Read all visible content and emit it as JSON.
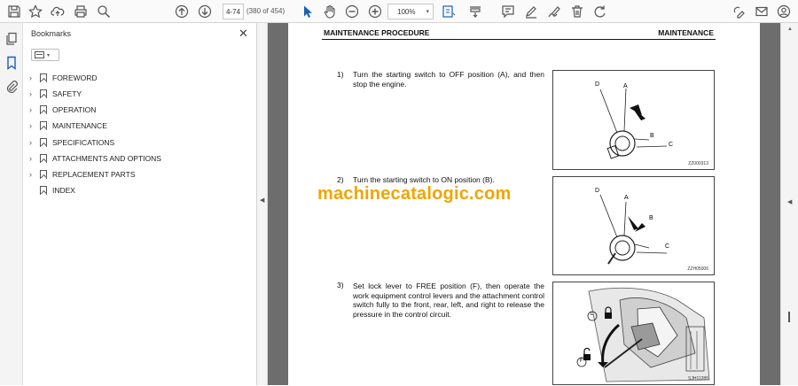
{
  "toolbar": {
    "page_current": "4-74",
    "page_count": "(380 of 454)",
    "zoom": "100%"
  },
  "bookmarks": {
    "title": "Bookmarks",
    "items": [
      {
        "label": "FOREWORD",
        "expandable": true
      },
      {
        "label": "SAFETY",
        "expandable": true
      },
      {
        "label": "OPERATION",
        "expandable": true
      },
      {
        "label": "MAINTENANCE",
        "expandable": true
      },
      {
        "label": "SPECIFICATIONS",
        "expandable": true
      },
      {
        "label": "ATTACHMENTS AND OPTIONS",
        "expandable": true
      },
      {
        "label": "REPLACEMENT PARTS",
        "expandable": true
      },
      {
        "label": "INDEX",
        "expandable": false
      }
    ]
  },
  "document": {
    "header_left": "MAINTENANCE PROCEDURE",
    "header_right": "MAINTENANCE",
    "watermark": "machinecatalogic.com",
    "steps": [
      {
        "num": "1)",
        "text": "Turn the starting switch to OFF position (A), and then stop the engine.",
        "fig_code": "ZZ000313",
        "fig_labels": [
          "D",
          "A",
          "B",
          "C"
        ]
      },
      {
        "num": "2)",
        "text": "Turn the starting switch to ON position (B).",
        "fig_code": "ZZH05006",
        "fig_labels": [
          "D",
          "A",
          "B",
          "C"
        ]
      },
      {
        "num": "3)",
        "text": "Set lock lever to FREE position (F), then operate the work equipment control levers and the attachment control switch fully to the front, rear, left, and right to release the pressure in the control circuit.",
        "fig_code": "SJH11285",
        "fig_labels": [
          "L",
          "F"
        ]
      }
    ]
  },
  "colors": {
    "watermark": "#f0a500",
    "doc_background": "#6d6d6d",
    "active_tool": "#1a5fb4"
  }
}
